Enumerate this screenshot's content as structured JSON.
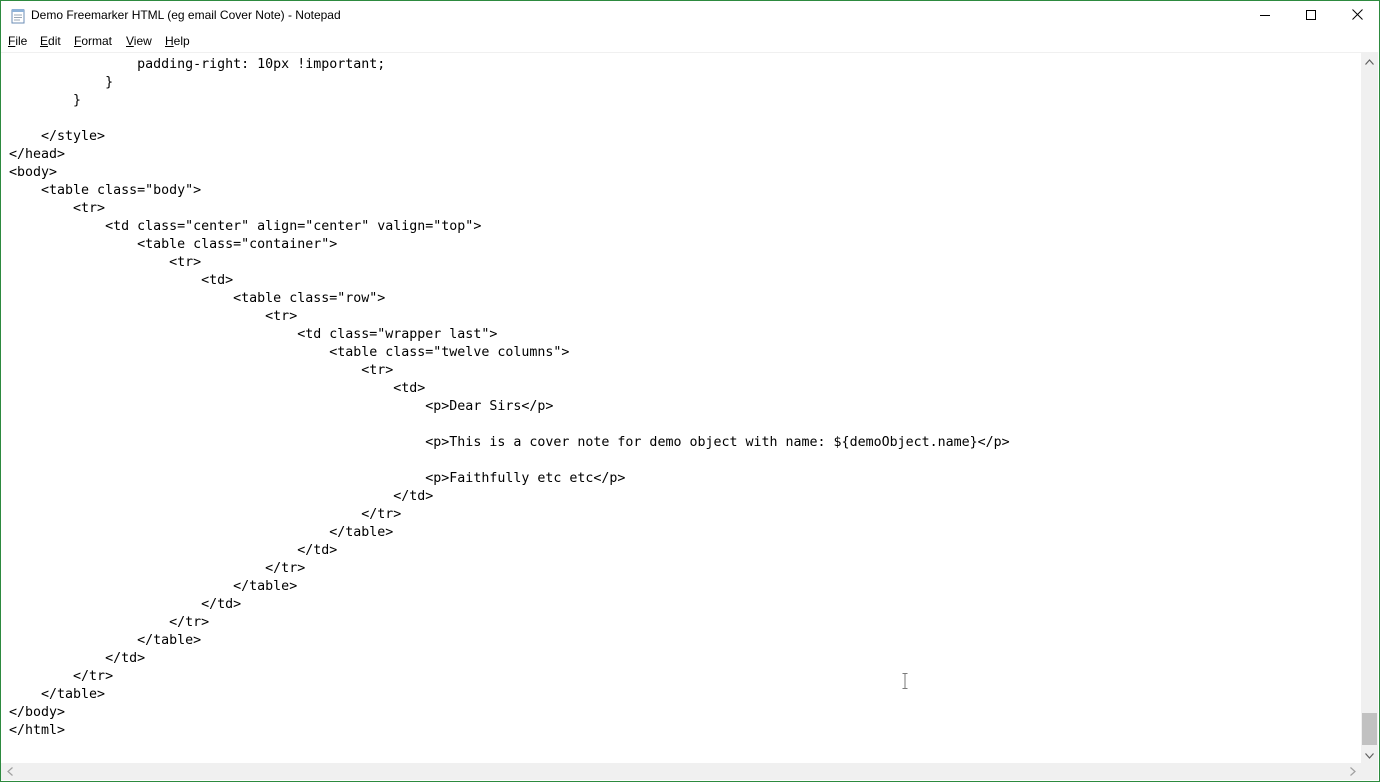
{
  "window": {
    "title": "Demo Freemarker HTML (eg email Cover Note) - Notepad",
    "app_icon": "notepad-icon",
    "controls": {
      "minimize_icon": "minimize-icon",
      "maximize_icon": "maximize-icon",
      "close_icon": "close-icon"
    }
  },
  "menu": {
    "file": {
      "accel": "F",
      "rest": "ile"
    },
    "edit": {
      "accel": "E",
      "rest": "dit"
    },
    "format": {
      "accel": "F",
      "rest": "ormat",
      "prefix": ""
    },
    "view": {
      "accel": "V",
      "rest": "iew"
    },
    "help": {
      "accel": "H",
      "rest": "elp"
    }
  },
  "editor": {
    "text": "                padding-right: 10px !important;\n            }\n        }\n\n    </style>\n</head>\n<body>\n    <table class=\"body\">\n        <tr>\n            <td class=\"center\" align=\"center\" valign=\"top\">\n                <table class=\"container\">\n                    <tr>\n                        <td>\n                            <table class=\"row\">\n                                <tr>\n                                    <td class=\"wrapper last\">\n                                        <table class=\"twelve columns\">\n                                            <tr>\n                                                <td>\n                                                    <p>Dear Sirs</p>\n\n                                                    <p>This is a cover note for demo object with name: ${demoObject.name}</p>\n\n                                                    <p>Faithfully etc etc</p>\n                                                </td>\n                                            </tr>\n                                        </table>\n                                    </td>\n                                </tr>\n                            </table>\n                        </td>\n                    </tr>\n                </table>\n            </td>\n        </tr>\n    </table>\n</body>\n</html>"
  },
  "scrollbars": {
    "vertical_position": 1.0,
    "up_icon": "scroll-up-arrow-icon",
    "down_icon": "scroll-down-arrow-icon",
    "left_icon": "scroll-left-arrow-icon",
    "right_icon": "scroll-right-arrow-icon"
  },
  "colors": {
    "window_border": "#2d8a3f",
    "scrollbar_track": "#f0f0f0",
    "scrollbar_thumb": "#c1c1c1"
  }
}
